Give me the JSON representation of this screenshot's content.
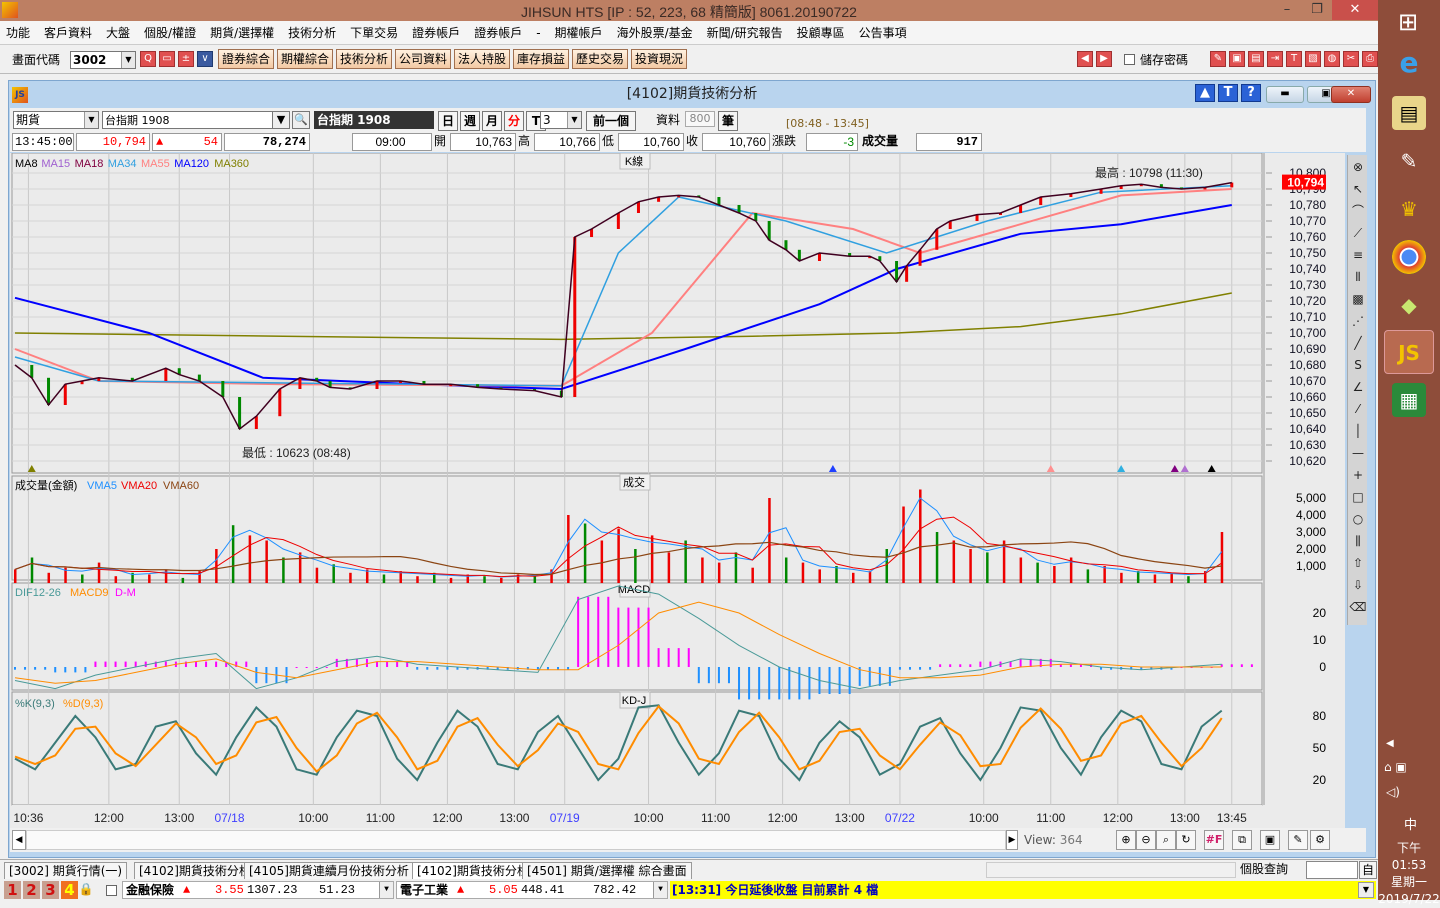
{
  "app": {
    "title": "JIHSUN HTS     [IP : 52, 223, 68 精簡版] 8061.20190722",
    "logo": "JS",
    "minimize": "–",
    "restore": "❐",
    "close": "✕"
  },
  "menu": [
    "功能",
    "客戶資料",
    "大盤",
    "個股/權證",
    "期貨/選擇權",
    "技術分析",
    "下單交易",
    "證券帳戶",
    "證券帳戶",
    "-",
    "期權帳戶",
    "海外股票/基金",
    "新聞/研究報告",
    "投顧專區",
    "公告事項"
  ],
  "toolbar": {
    "code_label": "畫面代碼",
    "code_value": "3002",
    "buttons": [
      "證券綜合",
      "期權綜合",
      "技術分析",
      "公司資料",
      "法人持股",
      "庫存損益",
      "歷史交易",
      "投資現況"
    ],
    "save_password": "儲存密碼",
    "save_password_checked": false
  },
  "window": {
    "title": "[4102]期貨技術分析",
    "help": "?",
    "top": "T"
  },
  "controls": {
    "market": "期貨",
    "symbol": "台指期 1908",
    "symbol_display": "台指期 1908",
    "periods": [
      "日",
      "週",
      "月",
      "分",
      "T"
    ],
    "active_period": "分",
    "interval": "3",
    "prev": "前一個",
    "data_label": "資料",
    "data_count": "800",
    "unit": "筆",
    "session": "[08:48 - 13:45]"
  },
  "quote": {
    "time": "13:45:00",
    "price": "10,794",
    "change": "54",
    "volume": "78,274",
    "bar_time": "09:00",
    "open_label": "開",
    "open": "10,763",
    "high_label": "高",
    "high": "10,766",
    "low_label": "低",
    "low": "10,760",
    "close_label": "收",
    "close": "10,760",
    "chg_label": "漲跌",
    "chg": "-3",
    "vol_label": "成交量",
    "vol": "917"
  },
  "colors": {
    "up": "#ff0000",
    "down": "#008000",
    "ma8": "#000000",
    "ma15": "#a060d0",
    "ma18": "#800040",
    "ma34": "#30a0e0",
    "ma55": "#ff8080",
    "ma120": "#0000ff",
    "ma360": "#808000"
  },
  "chart_data": {
    "type": "line",
    "panels": {
      "price": "K線",
      "volume": "成交",
      "macd": "MACD",
      "kd": "KD-J"
    },
    "x_ticks": [
      {
        "bar": 4,
        "label": "10:36"
      },
      {
        "bar": 28,
        "label": "12:00"
      },
      {
        "bar": 49,
        "label": "13:00"
      },
      {
        "bar": 64,
        "label": "07/18",
        "date": true
      },
      {
        "bar": 89,
        "label": "10:00"
      },
      {
        "bar": 109,
        "label": "11:00"
      },
      {
        "bar": 129,
        "label": "12:00"
      },
      {
        "bar": 149,
        "label": "13:00"
      },
      {
        "bar": 164,
        "label": "07/19",
        "date": true
      },
      {
        "bar": 189,
        "label": "10:00"
      },
      {
        "bar": 209,
        "label": "11:00"
      },
      {
        "bar": 229,
        "label": "12:00"
      },
      {
        "bar": 249,
        "label": "13:00"
      },
      {
        "bar": 264,
        "label": "07/22",
        "date": true
      },
      {
        "bar": 289,
        "label": "10:00"
      },
      {
        "bar": 309,
        "label": "11:00"
      },
      {
        "bar": 329,
        "label": "12:00"
      },
      {
        "bar": 349,
        "label": "13:00"
      },
      {
        "bar": 363,
        "label": "13:45"
      }
    ],
    "x_range": [
      0,
      364
    ],
    "price": {
      "legend": [
        "MA8",
        "MA15",
        "MA18",
        "MA34",
        "MA55",
        "MA120",
        "MA360"
      ],
      "y_ticks": [
        "10,620",
        "10,630",
        "10,640",
        "10,650",
        "10,660",
        "10,670",
        "10,680",
        "10,690",
        "10,700",
        "10,710",
        "10,720",
        "10,730",
        "10,740",
        "10,750",
        "10,760",
        "10,770",
        "10,780",
        "10,790",
        "10,800"
      ],
      "ylim": [
        10620,
        10800
      ],
      "last": "10,794",
      "last_value": 10794,
      "high_note": "最高 : 10798 (11:30)",
      "low_note": "最低 : 10623 (08:48)",
      "close": [
        [
          0,
          10680
        ],
        [
          5,
          10672
        ],
        [
          10,
          10655
        ],
        [
          15,
          10668
        ],
        [
          20,
          10670
        ],
        [
          25,
          10672
        ],
        [
          35,
          10670
        ],
        [
          45,
          10678
        ],
        [
          49,
          10674
        ],
        [
          55,
          10670
        ],
        [
          62,
          10660
        ],
        [
          67,
          10640
        ],
        [
          72,
          10648
        ],
        [
          79,
          10665
        ],
        [
          85,
          10672
        ],
        [
          90,
          10670
        ],
        [
          94,
          10666
        ],
        [
          100,
          10665
        ],
        [
          108,
          10670
        ],
        [
          115,
          10670
        ],
        [
          122,
          10668
        ],
        [
          130,
          10668
        ],
        [
          138,
          10666
        ],
        [
          145,
          10665
        ],
        [
          155,
          10664
        ],
        [
          163,
          10660
        ],
        [
          167,
          10760
        ],
        [
          172,
          10765
        ],
        [
          180,
          10775
        ],
        [
          186,
          10782
        ],
        [
          192,
          10785
        ],
        [
          198,
          10786
        ],
        [
          204,
          10785
        ],
        [
          210,
          10780
        ],
        [
          216,
          10775
        ],
        [
          221,
          10770
        ],
        [
          225,
          10758
        ],
        [
          230,
          10752
        ],
        [
          234,
          10745
        ],
        [
          240,
          10750
        ],
        [
          249,
          10748
        ],
        [
          255,
          10748
        ],
        [
          258,
          10745
        ],
        [
          263,
          10732
        ],
        [
          266,
          10742
        ],
        [
          270,
          10752
        ],
        [
          275,
          10765
        ],
        [
          279,
          10770
        ],
        [
          287,
          10774
        ],
        [
          294,
          10775
        ],
        [
          300,
          10780
        ],
        [
          306,
          10785
        ],
        [
          315,
          10787
        ],
        [
          324,
          10790
        ],
        [
          330,
          10792
        ],
        [
          336,
          10793
        ],
        [
          342,
          10791
        ],
        [
          348,
          10790
        ],
        [
          355,
          10791
        ],
        [
          363,
          10794
        ]
      ],
      "ma120": [
        [
          0,
          10722
        ],
        [
          40,
          10700
        ],
        [
          74,
          10672
        ],
        [
          120,
          10668
        ],
        [
          163,
          10665
        ],
        [
          200,
          10690
        ],
        [
          240,
          10718
        ],
        [
          263,
          10740
        ],
        [
          300,
          10762
        ],
        [
          330,
          10768
        ],
        [
          363,
          10780
        ]
      ],
      "ma360": [
        [
          0,
          10700
        ],
        [
          80,
          10698
        ],
        [
          163,
          10696
        ],
        [
          220,
          10698
        ],
        [
          263,
          10700
        ],
        [
          300,
          10704
        ],
        [
          330,
          10712
        ],
        [
          363,
          10725
        ]
      ],
      "ma55": [
        [
          0,
          10690
        ],
        [
          25,
          10670
        ],
        [
          80,
          10668
        ],
        [
          163,
          10667
        ],
        [
          190,
          10700
        ],
        [
          220,
          10775
        ],
        [
          250,
          10765
        ],
        [
          270,
          10750
        ],
        [
          295,
          10765
        ],
        [
          330,
          10786
        ],
        [
          363,
          10790
        ]
      ],
      "ma34": [
        [
          0,
          10685
        ],
        [
          25,
          10670
        ],
        [
          163,
          10667
        ],
        [
          180,
          10750
        ],
        [
          198,
          10785
        ],
        [
          230,
          10770
        ],
        [
          260,
          10750
        ],
        [
          290,
          10770
        ],
        [
          324,
          10788
        ],
        [
          363,
          10792
        ]
      ]
    },
    "volume": {
      "legend": [
        "成交量(金額)",
        "VMA5",
        "VMA20",
        "VMA60"
      ],
      "y_ticks": [
        "1,000",
        "2,000",
        "3,000",
        "4,000",
        "5,000"
      ],
      "ylim": [
        0,
        5000
      ],
      "bar_step": 5,
      "values": [
        800,
        1500,
        600,
        900,
        500,
        1200,
        400,
        600,
        500,
        800,
        300,
        700,
        2000,
        3400,
        2800,
        2500,
        1500,
        1800,
        900,
        1100,
        600,
        800,
        500,
        700,
        400,
        600,
        300,
        500,
        400,
        300,
        500,
        400,
        800,
        4000,
        3500,
        2500,
        3200,
        2000,
        2800,
        1800,
        2500,
        1500,
        1200,
        1800,
        900,
        5000,
        1500,
        1200,
        800,
        1000,
        600,
        700,
        2000,
        4500,
        5500,
        3000,
        2500,
        2000,
        1800,
        2500,
        1500,
        1200,
        1000,
        1500,
        800,
        1000,
        600,
        700,
        500,
        600,
        400,
        700,
        3000
      ]
    },
    "macd": {
      "legend": [
        "DIF12-26",
        "MACD9",
        "D-M"
      ],
      "y_ticks": [
        "0",
        "10",
        "20"
      ],
      "ylim": [
        -10,
        30
      ],
      "step": 12,
      "dif": [
        -5,
        -8,
        -3,
        0,
        3,
        5,
        -8,
        -4,
        2,
        4,
        1,
        0,
        -1,
        -2,
        25,
        30,
        27,
        18,
        8,
        0,
        -5,
        -8,
        -5,
        -3,
        -1,
        3,
        2,
        0,
        -1,
        0,
        1
      ],
      "macd": [
        -4,
        -6,
        -5,
        -2,
        1,
        3,
        -2,
        -4,
        -1,
        2,
        2,
        1,
        0,
        -1,
        -1,
        8,
        20,
        24,
        20,
        12,
        5,
        -1,
        -4,
        -4,
        -3,
        0,
        1,
        1,
        0,
        0,
        0
      ]
    },
    "kd": {
      "legend": [
        "%K(9,3)",
        "%D(9,3)"
      ],
      "y_ticks": [
        "20",
        "50",
        "80"
      ],
      "ylim": [
        0,
        100
      ],
      "step": 6,
      "k": [
        40,
        30,
        55,
        80,
        60,
        30,
        35,
        70,
        75,
        45,
        25,
        60,
        88,
        70,
        30,
        25,
        60,
        85,
        80,
        40,
        20,
        55,
        85,
        70,
        35,
        30,
        65,
        80,
        50,
        20,
        40,
        88,
        90,
        55,
        25,
        45,
        85,
        80,
        40,
        20,
        55,
        75,
        60,
        25,
        35,
        70,
        78,
        45,
        20,
        50,
        88,
        85,
        50,
        25,
        60,
        85,
        75,
        35,
        30,
        70,
        85
      ],
      "d": [
        42,
        35,
        43,
        68,
        70,
        45,
        33,
        53,
        73,
        60,
        35,
        43,
        74,
        79,
        50,
        28,
        43,
        73,
        83,
        60,
        30,
        38,
        70,
        78,
        53,
        33,
        48,
        73,
        65,
        35,
        30,
        64,
        89,
        73,
        40,
        35,
        65,
        83,
        60,
        30,
        38,
        65,
        68,
        43,
        30,
        53,
        74,
        62,
        33,
        35,
        69,
        87,
        68,
        38,
        43,
        73,
        80,
        55,
        33,
        50,
        78
      ]
    }
  },
  "tools": [
    "clear-tool",
    "select-tool",
    "arc-tool",
    "fan-tool",
    "gann-tool",
    "vertical-lines-tool",
    "grid-tool",
    "speed-lines-tool",
    "line-tool",
    "s-line-tool",
    "angle-tool",
    "segment-tool",
    "vertical-line-tool",
    "horizontal-line-tool",
    "crosshair-tool",
    "rectangle-tool",
    "ellipse-tool",
    "parallel-tool",
    "up-arrow-tool",
    "down-arrow-tool",
    "eraser-tool"
  ],
  "view": {
    "label": "View:",
    "count": "364"
  },
  "tabs": [
    "[3002] 期貨行情(一)",
    "[4102]期貨技術分析",
    "[4105]期貨連續月份技術分析",
    "[4102]期貨技術分析",
    "[4501] 期貨/選擇權 綜合畫面"
  ],
  "stock_query": {
    "label": "個股查詢",
    "go": "自"
  },
  "status": {
    "pages": [
      "1",
      "2",
      "3",
      "4"
    ],
    "sector1": {
      "name": "金融保險",
      "chg": "3.55",
      "index": "1307.23",
      "amount": "51.23"
    },
    "sector2": {
      "name": "電子工業",
      "chg": "5.05",
      "index": "448.41",
      "amount": "782.42"
    },
    "ticker": "[13:31]  今日延後收盤  目前累計  4  檔"
  },
  "taskbar": {
    "ime": "中",
    "time": "下午 01:53",
    "weekday": "星期一",
    "date": "2019/7/22"
  }
}
